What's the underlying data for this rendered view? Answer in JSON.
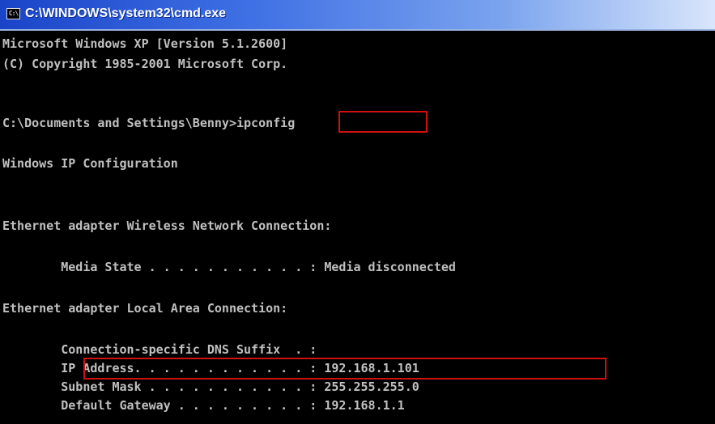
{
  "window": {
    "title": "C:\\WINDOWS\\system32\\cmd.exe",
    "icon_text": "C:\\"
  },
  "console": {
    "lines": [
      "Microsoft Windows XP [Version 5.1.2600]",
      "(C) Copyright 1985-2001 Microsoft Corp.",
      "",
      "C:\\Documents and Settings\\Benny>",
      "",
      "Windows IP Configuration",
      "",
      "",
      "Ethernet adapter Wireless Network Connection:",
      "",
      "        Media State . . . . . . . . . . . : Media disconnected",
      "",
      "Ethernet adapter Local Area Connection:",
      "",
      "        Connection-specific DNS Suffix  . :",
      "        IP Address. . . . . . . . . . . . : 192.168.1.101",
      "        Subnet Mask . . . . . . . . . . . : 255.255.255.0",
      "        Default Gateway . . . . . . . . . : 192.168.1.1"
    ],
    "command": "ipconfig"
  },
  "highlight_color": "#d11010"
}
